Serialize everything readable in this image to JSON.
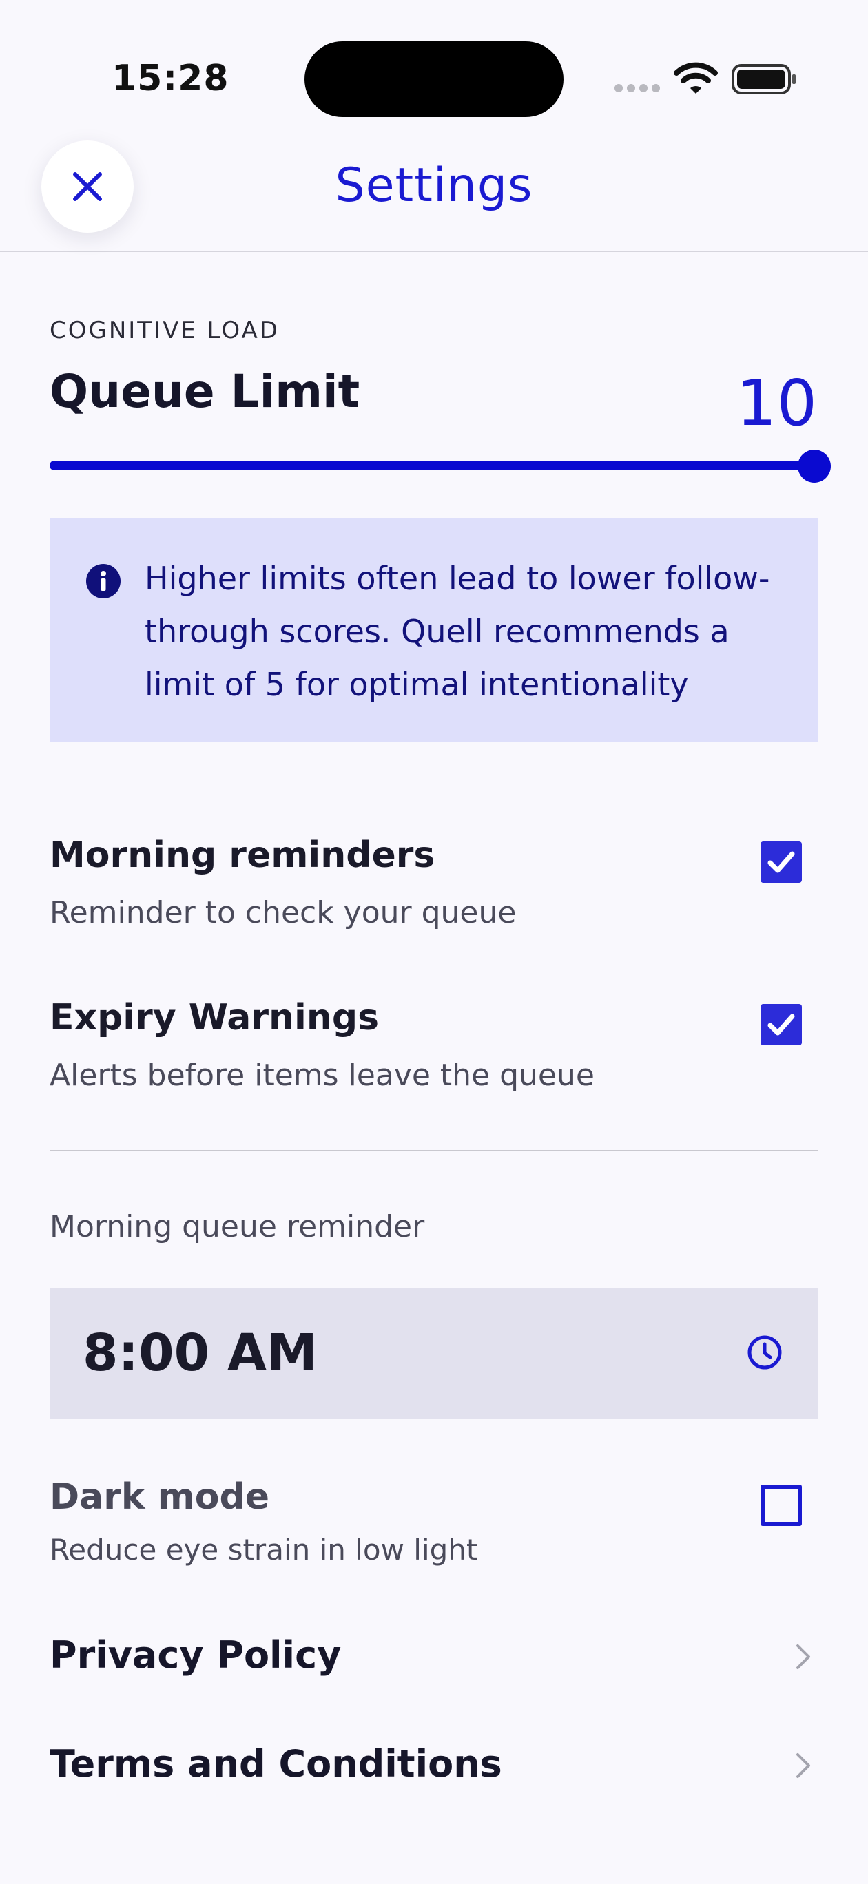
{
  "status_bar": {
    "time": "15:28",
    "icons": [
      "cellular-dots-icon",
      "wifi-icon",
      "battery-icon"
    ]
  },
  "header": {
    "title": "Settings",
    "close_icon": "close-icon"
  },
  "cognitive_load": {
    "eyebrow": "COGNITIVE LOAD",
    "title": "Queue Limit",
    "value": "10",
    "slider_fraction": 1.0
  },
  "info": {
    "icon": "info-icon",
    "text": "Higher limits often lead to lower follow-through scores. Quell recommends a limit of 5 for optimal intentionality"
  },
  "toggles": {
    "morning": {
      "title": "Morning reminders",
      "subtitle": "Reminder to check your queue",
      "checked": true
    },
    "expiry": {
      "title": "Expiry Warnings",
      "subtitle": "Alerts before items leave the queue",
      "checked": true
    },
    "dark": {
      "title": "Dark mode",
      "subtitle": "Reduce eye strain in low light",
      "checked": false
    }
  },
  "reminder": {
    "label": "Morning queue reminder",
    "time": "8:00 AM",
    "icon": "clock-icon"
  },
  "links": {
    "privacy": "Privacy Policy",
    "terms": "Terms and Conditions"
  },
  "colors": {
    "accent": "#1a1ad1",
    "info_bg": "#dedffb",
    "background": "#f9f8fd"
  }
}
